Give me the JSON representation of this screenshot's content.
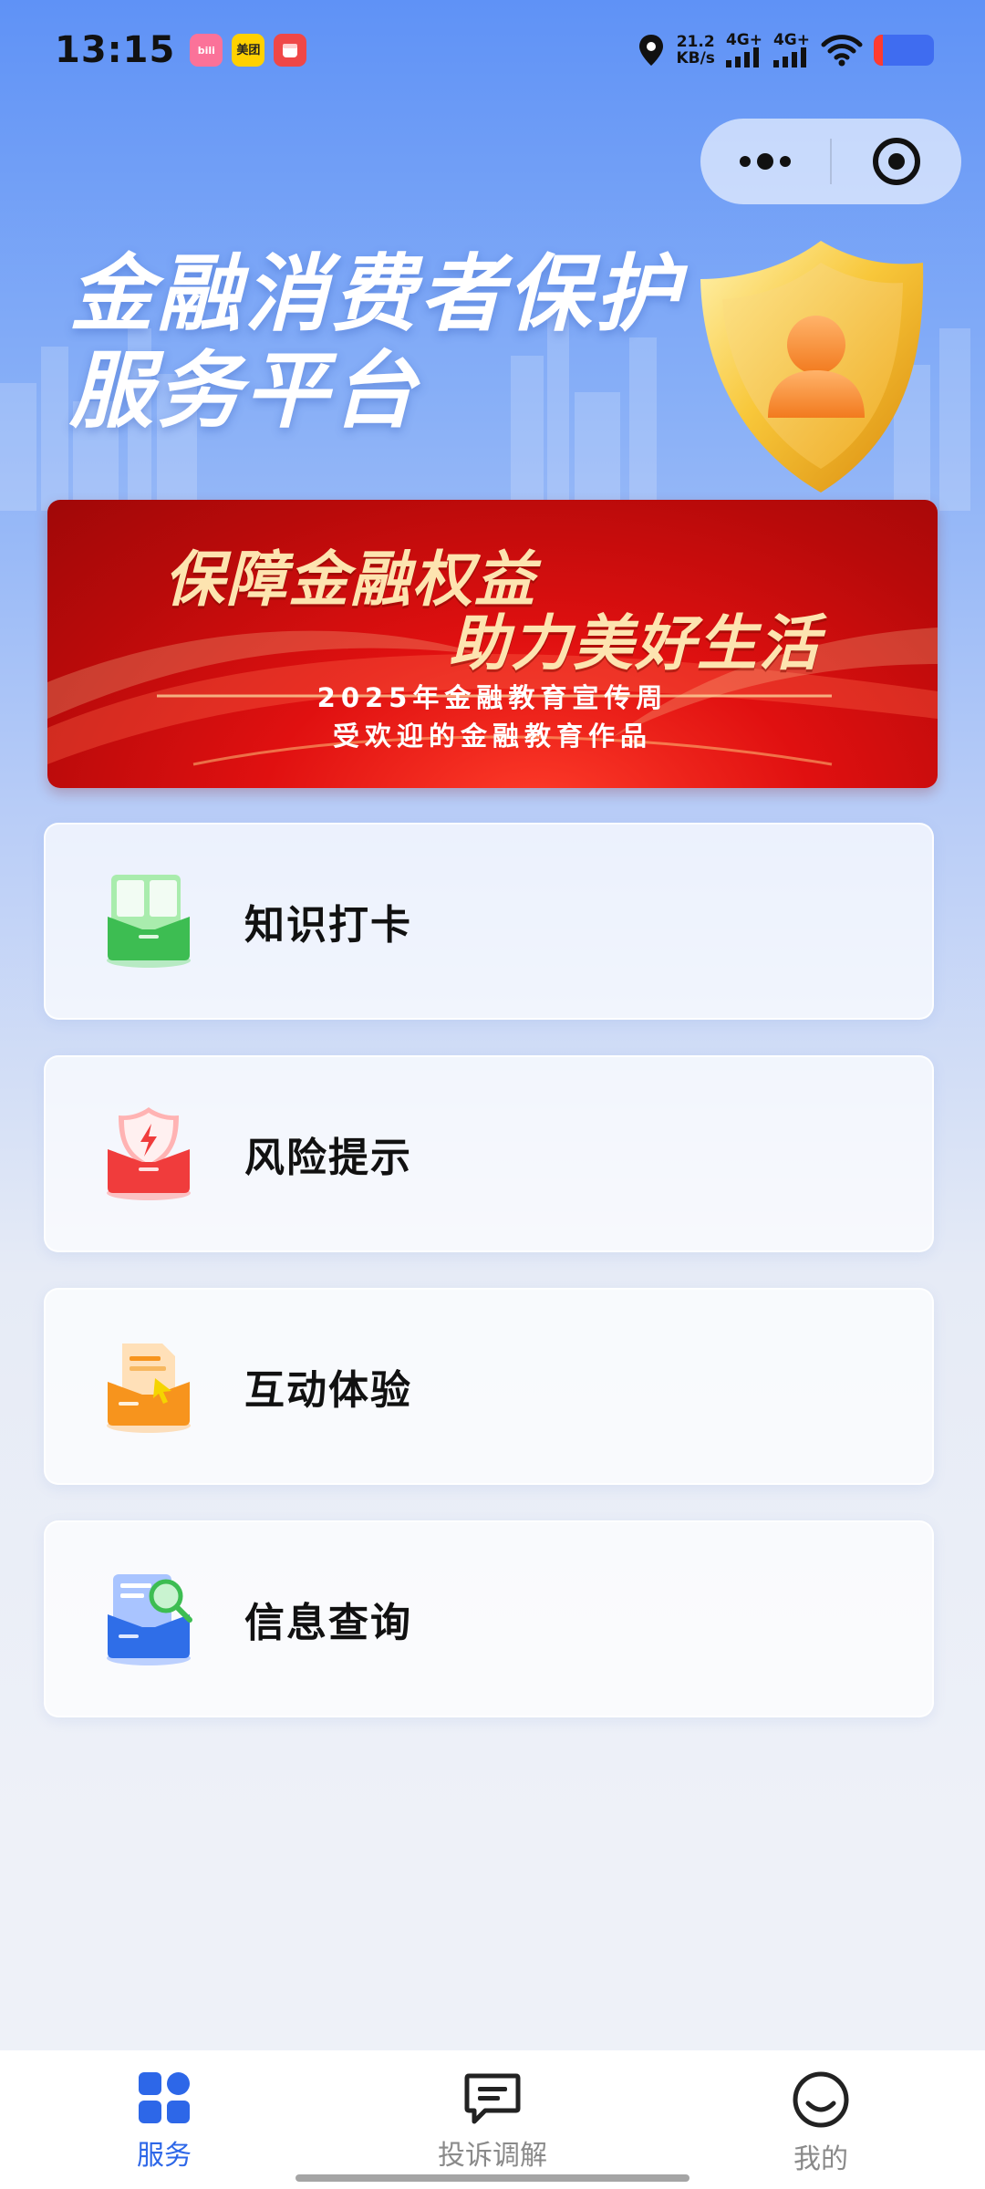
{
  "status_bar": {
    "time": "13:15",
    "app_icons": [
      "bilibili",
      "美团",
      "red-app"
    ],
    "speed_value": "21.2",
    "speed_unit": "KB/s",
    "network_1": "4G+",
    "network_2": "4G+",
    "battery_color": "#3f6cf0"
  },
  "capsule": {
    "more_icon": "more-dots-icon",
    "close_icon": "target-circle-icon"
  },
  "header": {
    "title_line1": "金融消费者保护",
    "title_line2": "服务平台"
  },
  "banner": {
    "line1": "保障金融权益",
    "line2": "助力美好生活",
    "sub1": "2025年金融教育宣传周",
    "sub2": "受欢迎的金融教育作品"
  },
  "menu": [
    {
      "label": "知识打卡",
      "icon": "book-icon",
      "color": "#3dbd52"
    },
    {
      "label": "风险提示",
      "icon": "shield-lightning-icon",
      "color": "#f03c3c"
    },
    {
      "label": "互动体验",
      "icon": "document-cursor-icon",
      "color": "#f7941d"
    },
    {
      "label": "信息查询",
      "icon": "document-search-icon",
      "color": "#2f6ee8"
    }
  ],
  "tabs": [
    {
      "label": "服务",
      "icon": "grid-icon",
      "active": true
    },
    {
      "label": "投诉调解",
      "icon": "chat-icon",
      "active": false
    },
    {
      "label": "我的",
      "icon": "smile-icon",
      "active": false
    }
  ],
  "colors": {
    "accent": "#2d67e8",
    "banner_red": "#d81212",
    "banner_text": "#fde4b0"
  }
}
